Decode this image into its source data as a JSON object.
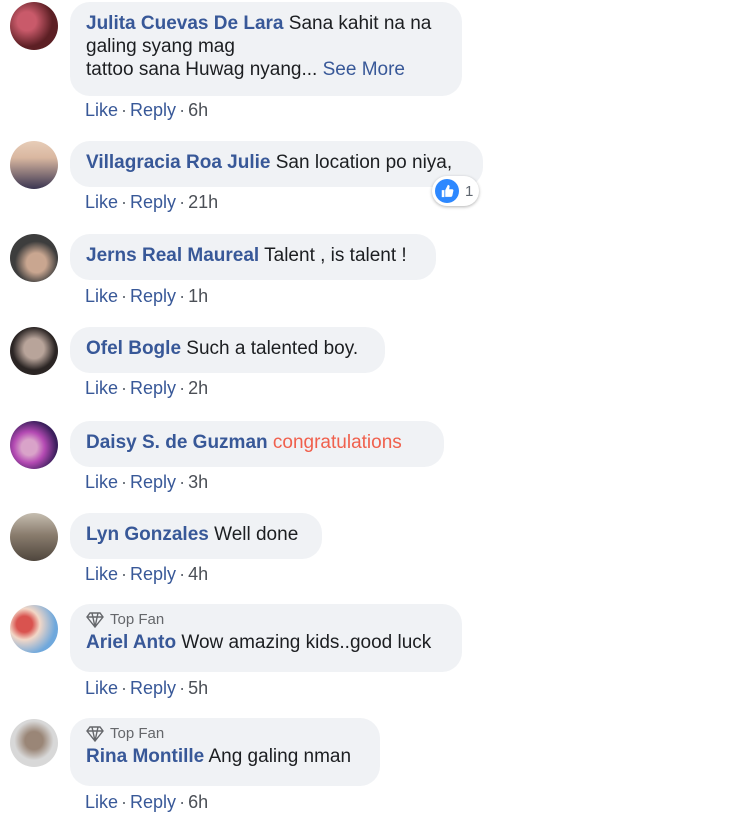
{
  "comments": [
    {
      "author": "Julita Cuevas De Lara",
      "text_line1": "Sana kahit na na",
      "text_line2": "galing syang mag",
      "text_line3": "tattoo sana Huwag nyang...",
      "see_more": "See More",
      "actions": {
        "like": "Like",
        "reply": "Reply",
        "time": "6h"
      },
      "avatar_colors": [
        "#5c1f24",
        "#c95a6a"
      ]
    },
    {
      "author": "Villagracia Roa Julie",
      "text": "San location po niya,",
      "reaction_count": "1",
      "actions": {
        "like": "Like",
        "reply": "Reply",
        "time": "21h"
      },
      "avatar_colors": [
        "#d9b7a0",
        "#3a3551"
      ]
    },
    {
      "author": "Jerns Real Maureal",
      "text": "Talent , is talent !",
      "actions": {
        "like": "Like",
        "reply": "Reply",
        "time": "1h"
      },
      "avatar_colors": [
        "#3d3d3d",
        "#c9a690"
      ]
    },
    {
      "author": "Ofel Bogle",
      "text": "Such a talented boy.",
      "actions": {
        "like": "Like",
        "reply": "Reply",
        "time": "2h"
      },
      "avatar_colors": [
        "#8a7d78",
        "#2b2524"
      ]
    },
    {
      "author": "Daisy S. de Guzman",
      "text": "congratulations",
      "actions": {
        "like": "Like",
        "reply": "Reply",
        "time": "3h"
      },
      "avatar_colors": [
        "#3b1f5c",
        "#b44ab3"
      ]
    },
    {
      "author": "Lyn Gonzales",
      "text": "Well done",
      "actions": {
        "like": "Like",
        "reply": "Reply",
        "time": "4h"
      },
      "avatar_colors": [
        "#6f6456",
        "#c5bdb0"
      ]
    },
    {
      "author": "Ariel Anto",
      "badge": "Top Fan",
      "text": "Wow amazing kids..good luck",
      "actions": {
        "like": "Like",
        "reply": "Reply",
        "time": "5h"
      },
      "avatar_colors": [
        "#d9534f",
        "#6fa8dc"
      ]
    },
    {
      "author": "Rina Montille",
      "badge": "Top Fan",
      "text": "Ang galing nman",
      "actions": {
        "like": "Like",
        "reply": "Reply",
        "time": "6h"
      },
      "avatar_colors": [
        "#d8d8d8",
        "#9a8677"
      ]
    }
  ],
  "colors": {
    "link": "#385898",
    "bubble": "#f0f2f5",
    "highlight": "#f0604d",
    "like_blue": "#2d88ff"
  }
}
